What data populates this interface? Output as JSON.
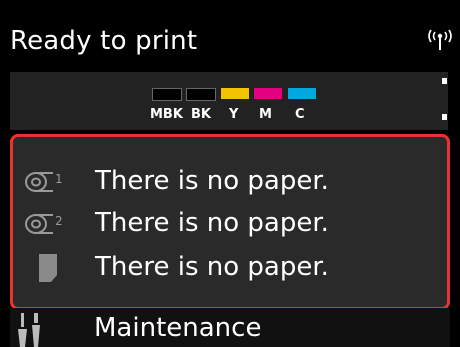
{
  "header": {
    "title": "Ready to print",
    "icon": "wireless-icon"
  },
  "inks": [
    {
      "label": "MBK",
      "color": "#000000"
    },
    {
      "label": "BK",
      "color": "#000000"
    },
    {
      "label": "Y",
      "color": "#f4c300"
    },
    {
      "label": "M",
      "color": "#e4007f"
    },
    {
      "label": "C",
      "color": "#00a7e1"
    }
  ],
  "status": {
    "rows": [
      {
        "icon": "roll-1-icon",
        "text": "There is no paper."
      },
      {
        "icon": "roll-2-icon",
        "text": "There is no paper."
      },
      {
        "icon": "cut-sheet-icon",
        "text": "There is no paper."
      }
    ],
    "highlight_color": "#e8332f"
  },
  "menu": {
    "maintenance_label": "Maintenance",
    "maintenance_icon": "maintenance-icon"
  }
}
